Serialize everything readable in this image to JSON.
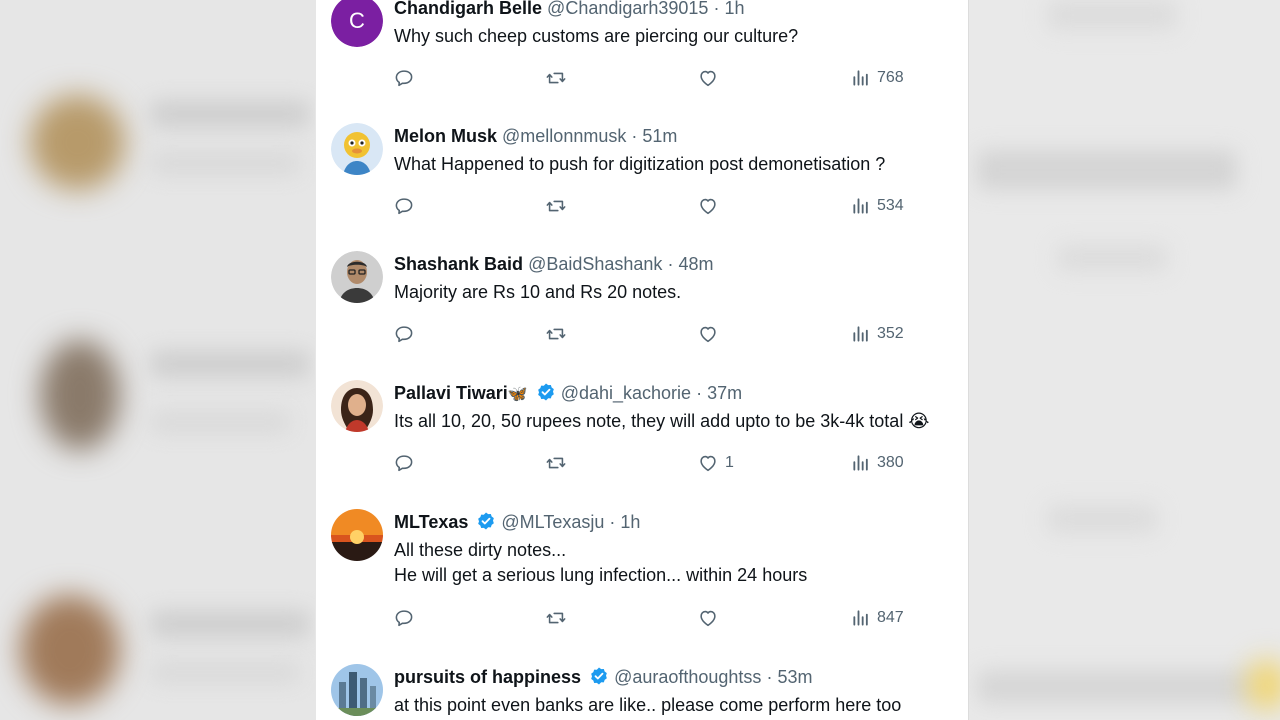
{
  "tweets": [
    {
      "avatar": "letter-avatar",
      "avatar_letter": "C",
      "avatar_color": "#7b1fa2",
      "name": "Chandigarh Belle",
      "handle": "@Chandigarh39015",
      "time": "1h",
      "lines": [
        "Why such cheep customs are piercing our culture?"
      ],
      "likes": "",
      "views": "768"
    },
    {
      "avatar": "cartoon-avatar",
      "name": "Melon Musk",
      "handle": "@mellonnmusk",
      "time": "51m",
      "lines": [
        "What Happened to push for digitization post demonetisation ?"
      ],
      "likes": "",
      "views": "534"
    },
    {
      "avatar": "man-photo-avatar",
      "name": "Shashank Baid",
      "handle": "@BaidShashank",
      "time": "48m",
      "lines": [
        "Majority are Rs 10 and Rs 20 notes."
      ],
      "likes": "",
      "views": "352"
    },
    {
      "avatar": "woman-photo-avatar",
      "name": "Pallavi Tiwari",
      "name_emoji": "🦋",
      "verified": true,
      "handle": "@dahi_kachorie",
      "time": "37m",
      "lines": [
        "Its all 10, 20, 50 rupees note, they will add upto to be 3k-4k total 😭"
      ],
      "likes": "1",
      "views": "380"
    },
    {
      "avatar": "sunset-avatar",
      "name": "MLTexas",
      "verified": true,
      "handle": "@MLTexasju",
      "time": "1h",
      "lines": [
        "All these dirty notes...",
        "He will get a serious lung infection... within 24 hours"
      ],
      "likes": "",
      "views": "847"
    },
    {
      "avatar": "skyline-avatar",
      "name": "pursuits of happiness",
      "verified": true,
      "handle": "@auraofthoughtss",
      "time": "53m",
      "lines": [
        "at this point even banks are like.. please come perform here too"
      ],
      "likes": "",
      "views": ""
    }
  ],
  "separator": "·",
  "colors": {
    "text": "#0f1419",
    "secondary": "#536471",
    "verified": "#1d9bf0",
    "background": "#ffffff"
  },
  "icons": [
    "reply-icon",
    "retweet-icon",
    "like-icon",
    "views-icon",
    "verified-badge-icon"
  ]
}
